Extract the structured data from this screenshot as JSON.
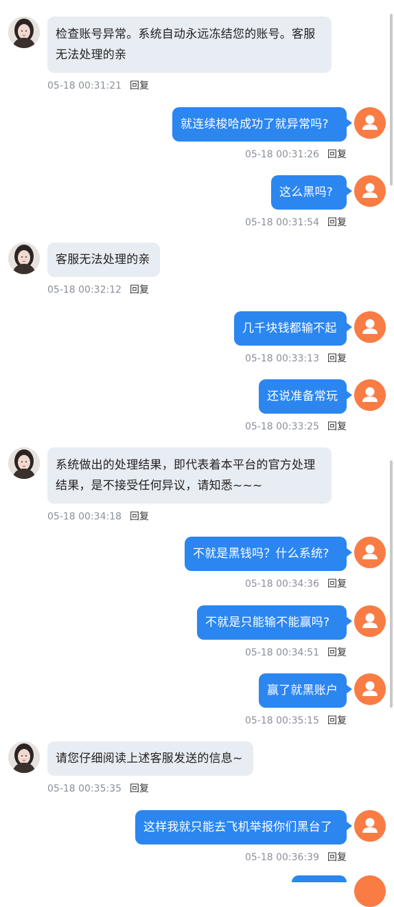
{
  "colors": {
    "agent_bubble": "#e8ecf3",
    "user_bubble": "#2b86f0",
    "user_avatar": "#f97c44",
    "timestamp": "#8a8f99"
  },
  "icons": {
    "agent_avatar": "woman-portrait-avatar",
    "user_avatar": "person-icon"
  },
  "messages": [
    {
      "side": "left",
      "text": "检查账号异常。系统自动永远冻结您的账号。客服\n无法处理的亲",
      "time": "05-18 00:31:21",
      "reply": "回复"
    },
    {
      "side": "right",
      "text": "就连续梭哈成功了就异常吗?",
      "time": "05-18 00:31:26",
      "reply": "回复"
    },
    {
      "side": "right",
      "text": "这么黑吗?",
      "time": "05-18 00:31:54",
      "reply": "回复"
    },
    {
      "side": "left",
      "text": "客服无法处理的亲",
      "time": "05-18 00:32:12",
      "reply": "回复"
    },
    {
      "side": "right",
      "text": "几千块钱都输不起",
      "time": "05-18 00:33:13",
      "reply": "回复"
    },
    {
      "side": "right",
      "text": "还说准备常玩",
      "time": "05-18 00:33:25",
      "reply": "回复"
    },
    {
      "side": "left",
      "text": "系统做出的处理结果，即代表着本平台的官方处理\n结果，是不接受任何异议，请知悉~~~",
      "time": "05-18 00:34:18",
      "reply": "回复"
    },
    {
      "side": "right",
      "text": "不就是黑钱吗？什么系统?",
      "time": "05-18 00:34:36",
      "reply": "回复"
    },
    {
      "side": "right",
      "text": "不就是只能输不能赢吗?",
      "time": "05-18 00:34:51",
      "reply": "回复"
    },
    {
      "side": "right",
      "text": "赢了就黑账户",
      "time": "05-18 00:35:15",
      "reply": "回复"
    },
    {
      "side": "left",
      "text": "请您仔细阅读上述客服发送的信息~",
      "time": "05-18 00:35:35",
      "reply": "回复"
    },
    {
      "side": "right",
      "text": "这样我就只能去飞机举报你们黑台了",
      "time": "05-18 00:36:39",
      "reply": "回复"
    }
  ]
}
